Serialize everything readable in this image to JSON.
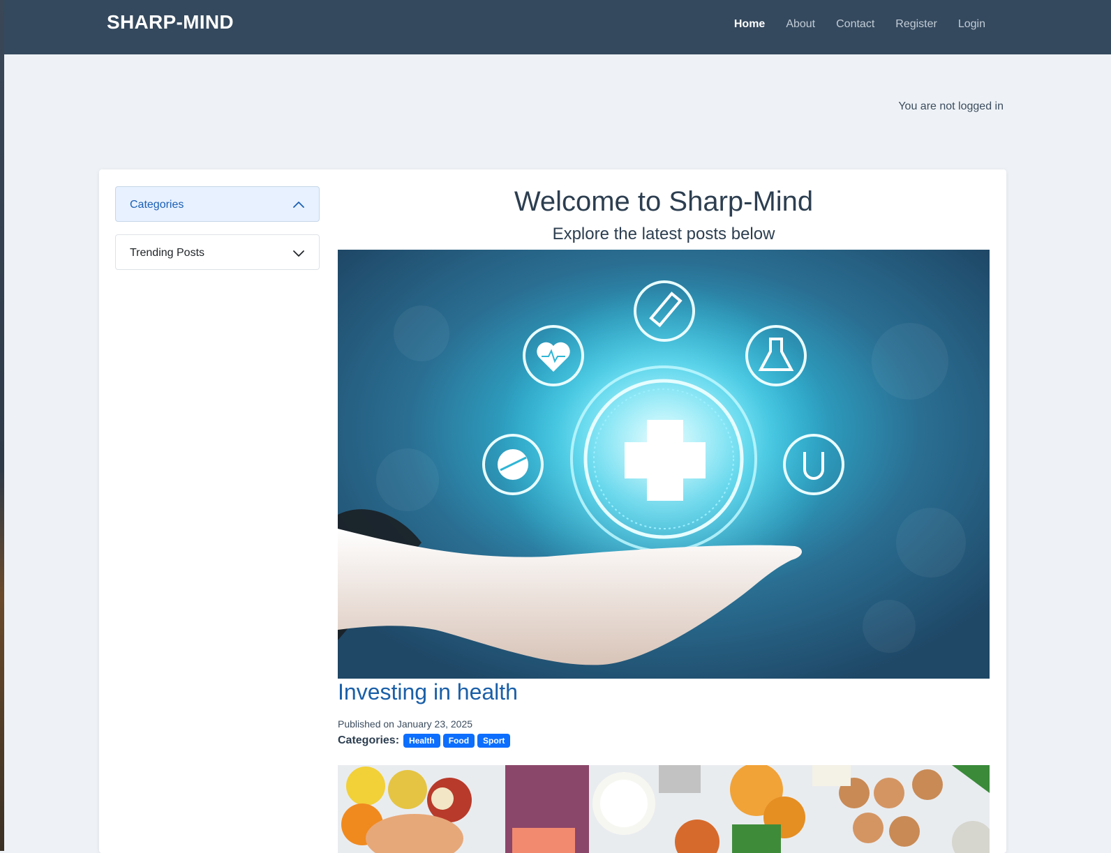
{
  "navbar": {
    "brand": "SHARP-MIND",
    "links": [
      {
        "label": "Home",
        "active": true
      },
      {
        "label": "About"
      },
      {
        "label": "Contact"
      },
      {
        "label": "Register"
      },
      {
        "label": "Login"
      }
    ]
  },
  "status": {
    "login_text": "You are not logged in"
  },
  "sidebar": {
    "accordions": [
      {
        "label": "Categories",
        "expanded": true,
        "icon": "chevron-up-icon"
      },
      {
        "label": "Trending Posts",
        "expanded": false,
        "icon": "chevron-down-icon"
      }
    ]
  },
  "main": {
    "title": "Welcome to Sharp-Mind",
    "subtitle": "Explore the latest posts below",
    "posts": [
      {
        "title": "Investing in health",
        "published": "Published on January 23, 2025",
        "categories_label": "Categories:",
        "categories": [
          "Health",
          "Food",
          "Sport"
        ]
      }
    ]
  },
  "colors": {
    "navbar": "#34495e",
    "accent": "#0d6efd",
    "link": "#1a5fa8",
    "page_bg": "#eef2f6"
  }
}
